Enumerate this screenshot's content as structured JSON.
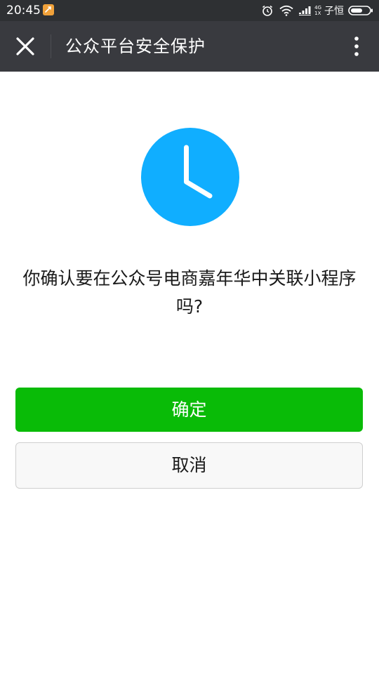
{
  "status_bar": {
    "time": "20:45",
    "network_top": "4G",
    "network_bottom": "1X",
    "carrier": "子恒",
    "icons": [
      "app-notification-icon",
      "alarm-icon",
      "wifi-icon",
      "signal-icon",
      "battery-icon"
    ]
  },
  "nav": {
    "title": "公众平台安全保护",
    "close_icon": "close-icon",
    "more_icon": "more-vertical-icon"
  },
  "content": {
    "icon": "clock-icon",
    "prompt": "你确认要在公众号电商嘉年华中关联小程序吗?"
  },
  "buttons": {
    "confirm_label": "确定",
    "cancel_label": "取消"
  },
  "colors": {
    "status_bar_bg": "#2e3033",
    "nav_bg": "#393a3f",
    "accent_blue": "#10aeff",
    "confirm_green": "#09bb07",
    "cancel_bg": "#f8f8f8"
  }
}
